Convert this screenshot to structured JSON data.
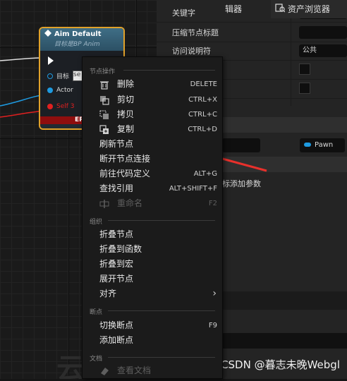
{
  "node": {
    "title": "Aim Default",
    "subtitle": "目标是BP Anim",
    "pins": [
      {
        "label": "目标",
        "value": "se"
      },
      {
        "label": "Actor"
      },
      {
        "label": "Self 3"
      }
    ],
    "error": "ERR"
  },
  "details": {
    "rows": [
      {
        "label": "关键字"
      },
      {
        "label": "压缩节点标题"
      },
      {
        "label": "访问说明符",
        "value": "公共"
      }
    ],
    "pawn_value": "Pawn",
    "add_param_label": "标添加参数",
    "tabs": [
      "辑器",
      "资产浏览器"
    ]
  },
  "menu": {
    "sections": {
      "node_ops": "节点操作",
      "organize": "组织",
      "breakpoints": "断点",
      "docs": "文档"
    },
    "items": {
      "delete": {
        "label": "删除",
        "shortcut": "DELETE"
      },
      "cut": {
        "label": "剪切",
        "shortcut": "CTRL+X"
      },
      "copy": {
        "label": "拷贝",
        "shortcut": "CTRL+C"
      },
      "duplicate": {
        "label": "复制",
        "shortcut": "CTRL+D"
      },
      "refresh": {
        "label": "刷新节点"
      },
      "break_links": {
        "label": "断开节点连接"
      },
      "goto_def": {
        "label": "前往代码定义",
        "shortcut": "ALT+G"
      },
      "find_refs": {
        "label": "查找引用",
        "shortcut": "ALT+SHIFT+F"
      },
      "rename": {
        "label": "重命名",
        "shortcut": "F2"
      },
      "collapse_nodes": {
        "label": "折叠节点"
      },
      "collapse_func": {
        "label": "折叠到函数"
      },
      "collapse_macro": {
        "label": "折叠到宏"
      },
      "expand": {
        "label": "展开节点"
      },
      "align": {
        "label": "对齐"
      },
      "toggle_bp": {
        "label": "切换断点",
        "shortcut": "F9"
      },
      "add_bp": {
        "label": "添加断点"
      },
      "view_docs": {
        "label": "查看文档"
      }
    }
  },
  "watermark": "CSDN @暮志未晚Webgl",
  "colors": {
    "node_border": "#e0a12a",
    "arrow": "#e8302b",
    "error_bar": "#8f0e0e",
    "pin_blue": "#1e9ae0",
    "pin_red": "#e02020"
  }
}
